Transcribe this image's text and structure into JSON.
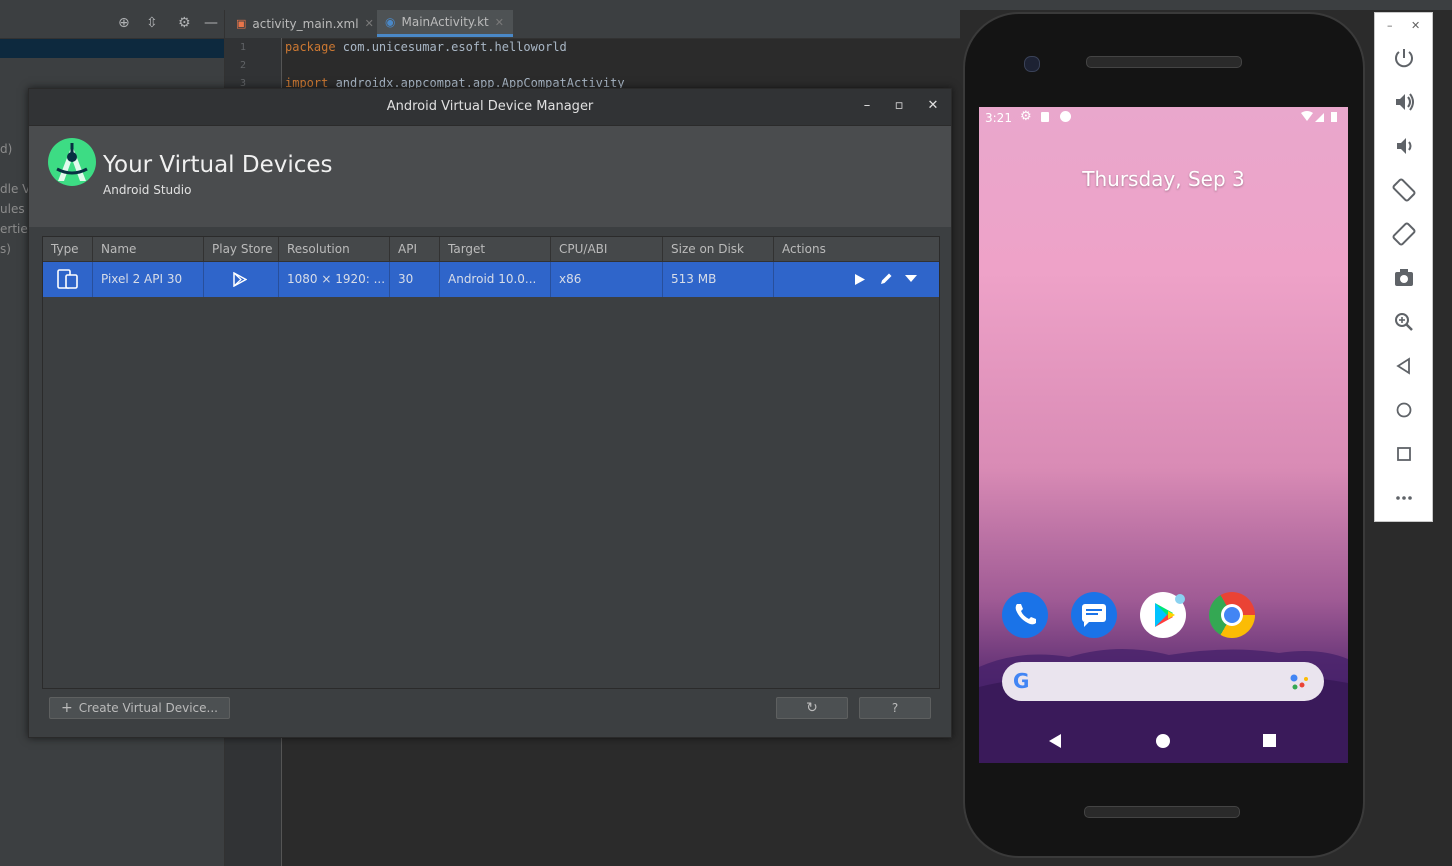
{
  "ide": {
    "editor_tabs": [
      {
        "label": "activity_main.xml",
        "active": false
      },
      {
        "label": "MainActivity.kt",
        "active": true
      }
    ],
    "project_side_labels": [
      "d)",
      "dle V",
      "ules",
      "erties",
      "s)"
    ],
    "code_lines": [
      {
        "num": "1",
        "keyword": "package",
        "text": " com.unicesumar.esoft.helloworld"
      },
      {
        "num": "2",
        "keyword": "",
        "text": ""
      },
      {
        "num": "3",
        "keyword": "import",
        "text": " androidx.appcompat.app.AppCompatActivity"
      }
    ]
  },
  "avd": {
    "window_title": "Android Virtual Device Manager",
    "heading": "Your Virtual Devices",
    "subheading": "Android Studio",
    "columns": [
      "Type",
      "Name",
      "Play Store",
      "Resolution",
      "API",
      "Target",
      "CPU/ABI",
      "Size on Disk",
      "Actions"
    ],
    "device": {
      "name": "Pixel 2 API 30",
      "resolution": "1080 × 1920: ...",
      "api": "30",
      "target": "Android 10.0...",
      "cpu": "x86",
      "size": "513 MB"
    },
    "create_button": "Create Virtual Device...",
    "help_button": "?"
  },
  "phone": {
    "time": "3:21",
    "date": "Thursday, Sep 3"
  },
  "colors": {
    "selection": "#2f65ca",
    "dialog_bg": "#3c3f41",
    "android_green": "#3ddc84"
  }
}
